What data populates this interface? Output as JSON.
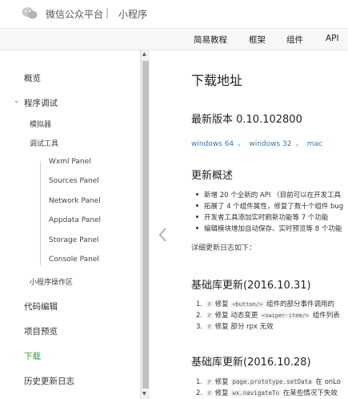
{
  "header": {
    "brand": "微信公众平台",
    "separator": "|",
    "subtitle": "小程序"
  },
  "nav": {
    "items": [
      "简易教程",
      "框架",
      "组件",
      "API"
    ]
  },
  "sidebar": {
    "overview": "概览",
    "debug": "程序调试",
    "simulator": "模拟器",
    "debug_tools": "调试工具",
    "panels": [
      "Wxml Panel",
      "Sources Panel",
      "Network Panel",
      "Appdata Panel",
      "Storage Panel",
      "Console Panel"
    ],
    "operations": "小程序操作区",
    "code_edit": "代码编辑",
    "preview": "项目预览",
    "download": "下载",
    "history": "历史更新日志"
  },
  "main": {
    "title": "下载地址",
    "latest": "最新版本 0.10.102800",
    "links": {
      "win64": "windows 64",
      "sep1": "、",
      "win32": "windows 32",
      "sep2": "、",
      "mac": "mac"
    },
    "overview_title": "更新概述",
    "bullets": [
      "新增 20 个全新的 API （目前可以在开发工具",
      "拓展了 4 个组件属性，修复了数十个组件 bug",
      "开发者工具添加实时刷新功能等 7 个功能",
      "编辑模块增加自动保存、实时预览等 8 个功能"
    ],
    "detail_log": "详细更新日志如下：",
    "lib1": {
      "title": "基础库更新(2016.10.31)",
      "items": [
        {
          "num": "1.",
          "badge": "F",
          "pre": "修复",
          "code": "<button/>",
          "post": "组件的部分事件调用的"
        },
        {
          "num": "2.",
          "badge": "F",
          "pre": "修复 动态变更",
          "code": "<swiper-item/>",
          "post": "组件列表"
        },
        {
          "num": "3.",
          "badge": "F",
          "pre": "修复 部分 rpx 无效",
          "code": "",
          "post": ""
        }
      ]
    },
    "lib2": {
      "title": "基础库更新(2016.10.28)",
      "items": [
        {
          "num": "1.",
          "badge": "F",
          "pre": "修复",
          "code": "page.prototype.setData",
          "post": "在 onLo"
        },
        {
          "num": "2.",
          "badge": "F",
          "pre": "修复",
          "code": "wx.navigateTo",
          "post": "在某些情况下失效"
        }
      ]
    }
  },
  "colors": {
    "accent_green": "#2ba245",
    "link_blue": "#2a7bc0"
  }
}
